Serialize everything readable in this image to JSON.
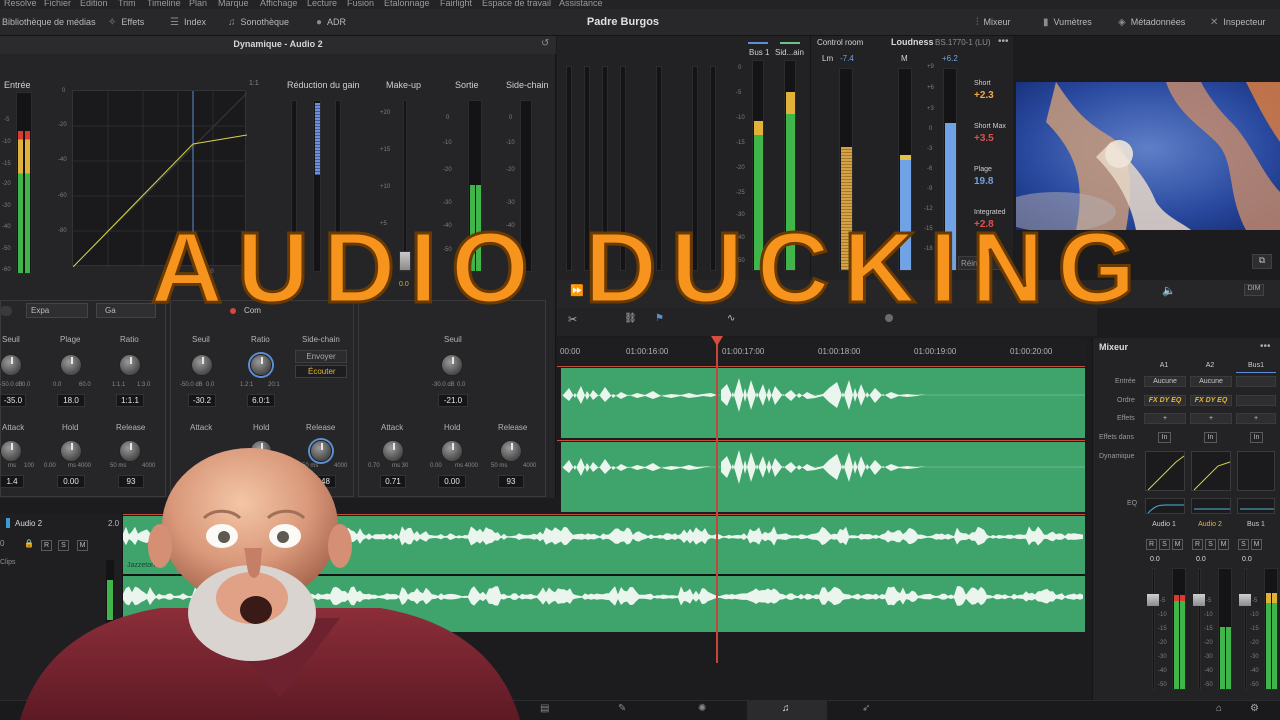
{
  "menubar": {
    "items": [
      "Resolve",
      "Fichier",
      "Edition",
      "Trim",
      "Timeline",
      "Plan",
      "Marque",
      "Affichage",
      "Lecture",
      "Fusion",
      "Étalonnage",
      "Fairlight",
      "Espace de travail",
      "Assistance"
    ]
  },
  "toolbar": {
    "left": [
      {
        "label": "Bibliothèque de médias",
        "icon": "media-pool-icon"
      },
      {
        "label": "Effets",
        "icon": "effects-icon"
      },
      {
        "label": "Index",
        "icon": "index-icon"
      },
      {
        "label": "Sonothèque",
        "icon": "sound-library-icon"
      },
      {
        "label": "ADR",
        "icon": "adr-icon"
      }
    ],
    "project_title": "Padre Burgos",
    "right": [
      {
        "label": "Mixeur",
        "icon": "mixer-icon"
      },
      {
        "label": "Vumètres",
        "icon": "meters-icon"
      },
      {
        "label": "Métadonnées",
        "icon": "metadata-icon"
      },
      {
        "label": "Inspecteur",
        "icon": "inspector-icon"
      }
    ]
  },
  "dynamics": {
    "title": "Dynamique - Audio 2",
    "ratio_marker": "1:1",
    "sections": {
      "input": "Entrée",
      "gain_reduction": "Réduction du gain",
      "makeup": "Make-up",
      "output": "Sortie",
      "sidechain": "Side-chain"
    },
    "graph_ticks": [
      "0",
      "-20",
      "-40",
      "-60",
      "-80"
    ],
    "graph_xtick": "-20",
    "makeup_ticks": [
      "+20",
      "+15",
      "+10",
      "+5"
    ],
    "output_ticks": [
      "0",
      "-10",
      "-20",
      "-30",
      "-40",
      "-50"
    ],
    "input_ticks": [
      "-5",
      "-10",
      "-15",
      "-20",
      "-30",
      "-40",
      "-50",
      "-60"
    ],
    "makeup_value": "0.0",
    "expander": {
      "tab_a": "Expa",
      "tab_b": "Ga",
      "seuil_label": "Seuil",
      "seuil_range_min": "-50.0 dB",
      "seuil_range_max": "0.0",
      "seuil_value": "-35.0",
      "plage_label": "Plage",
      "plage_range_min": "0.0",
      "plage_range_max": "60.0",
      "plage_value": "18.0",
      "ratio_label": "Ratio",
      "ratio_range_min": "1:1.1",
      "ratio_range_max": "1:3.0",
      "ratio_value": "1:1.1",
      "attack_label": "Attack",
      "attack_range_min": "ms",
      "attack_range_max": "100",
      "attack_value": "1.4",
      "hold_label": "Hold",
      "hold_range_min": "0.00",
      "hold_range_max": "ms 4000",
      "hold_value": "0.00",
      "release_label": "Release",
      "release_range_min": "50 ms",
      "release_range_max": "4000",
      "release_value": "93"
    },
    "compressor": {
      "tab": "Com",
      "seuil_label": "Seuil",
      "seuil_range_min": "-50.0 dB",
      "seuil_range_max": "0.0",
      "seuil_value": "-30.2",
      "ratio_label": "Ratio",
      "ratio_range_min": "1.2:1",
      "ratio_range_max": "20:1",
      "ratio_value": "6.0:1",
      "sidechain_label": "Side-chain",
      "send_label": "Envoyer",
      "listen_label": "Écouter",
      "attack_label": "Attack",
      "hold_label": "Hold",
      "release_label": "Release",
      "release_range_min": "50 ms",
      "release_range_max": "4000",
      "release_value": "1048"
    },
    "limiter": {
      "seuil_label": "Seuil",
      "seuil_range_min": "-30.0 dB",
      "seuil_range_max": "0.0",
      "seuil_value": "-21.0",
      "attack_label": "Attack",
      "attack_range_min": "0.70",
      "attack_range_max": "ms 30",
      "attack_value": "0.71",
      "hold_label": "Hold",
      "hold_range_min": "0.00",
      "hold_range_max": "ms 4000",
      "hold_value": "0.00",
      "release_label": "Release",
      "release_range_min": "50 ms",
      "release_range_max": "4000",
      "release_value": "93"
    }
  },
  "meters": {
    "bus1_label": "Bus 1",
    "sidechain_label": "Sid...ain",
    "bus_ticks": [
      "0",
      "-5",
      "-10",
      "-15",
      "-20",
      "-25",
      "-30",
      "-40",
      "-50"
    ],
    "control_room": "Control room",
    "lm_label": "Lm",
    "lm_value": "-7.4",
    "loudness_label": "Loudness",
    "loudness_standard": "BS.1770-1 (LU)",
    "m_label": "M",
    "m_ticks": [
      "+9",
      "+6",
      "+3",
      "0",
      "-3",
      "-6",
      "-9",
      "-12",
      "-15",
      "-18"
    ],
    "m_peak": "+6.2",
    "short_label": "Short",
    "short_value": "+2.3",
    "short_max_label": "Short Max",
    "short_max_value": "+3.5",
    "range_label": "Plage",
    "range_value": "19.8",
    "integrated_label": "Integrated",
    "integrated_value": "+2.8",
    "reset_label": "Réini",
    "levels": {
      "bus1": 0.72,
      "sidechain": 0.86,
      "lm": 0.62,
      "m": 0.58,
      "loud": 0.74
    }
  },
  "timeline": {
    "ruler": [
      "00:00",
      "01:00:16:00",
      "01:00:17:00",
      "01:00:18:00",
      "01:00:19:00",
      "01:00:20:00"
    ],
    "track_name": "Audio 2",
    "track_level": "2.0",
    "track_sub": "Clips",
    "clip_name": "Jazzeton"
  },
  "mixer": {
    "title": "Mixeur",
    "columns": [
      "A1",
      "A2",
      "Bus1"
    ],
    "rows": {
      "input": "Entrée",
      "order": "Ordre",
      "effects": "Effets",
      "effects_in": "Effets dans",
      "dynamics": "Dynamique",
      "eq": "EQ"
    },
    "input_values": [
      "Aucune",
      "Aucune",
      ""
    ],
    "order_values": [
      "FX DY EQ",
      "FX DY EQ",
      ""
    ],
    "channel_names": [
      "Audio 1",
      "Audio 2",
      "Bus 1"
    ],
    "channel_levels": [
      "0.0",
      "0.0",
      "0.0"
    ],
    "fader_ticks": [
      "-5",
      "-10",
      "-15",
      "-20",
      "-30",
      "-40",
      "-50"
    ]
  },
  "overlay": {
    "headline": "AUDIO DUCKING"
  },
  "colors": {
    "accent_orange": "#f7941d",
    "wave_green": "#3fa36c",
    "playhead_red": "#c8443a",
    "loudness_orange": "#f2a94a",
    "loudness_red": "#e0504a",
    "loudness_blue": "#6fa3e6"
  }
}
